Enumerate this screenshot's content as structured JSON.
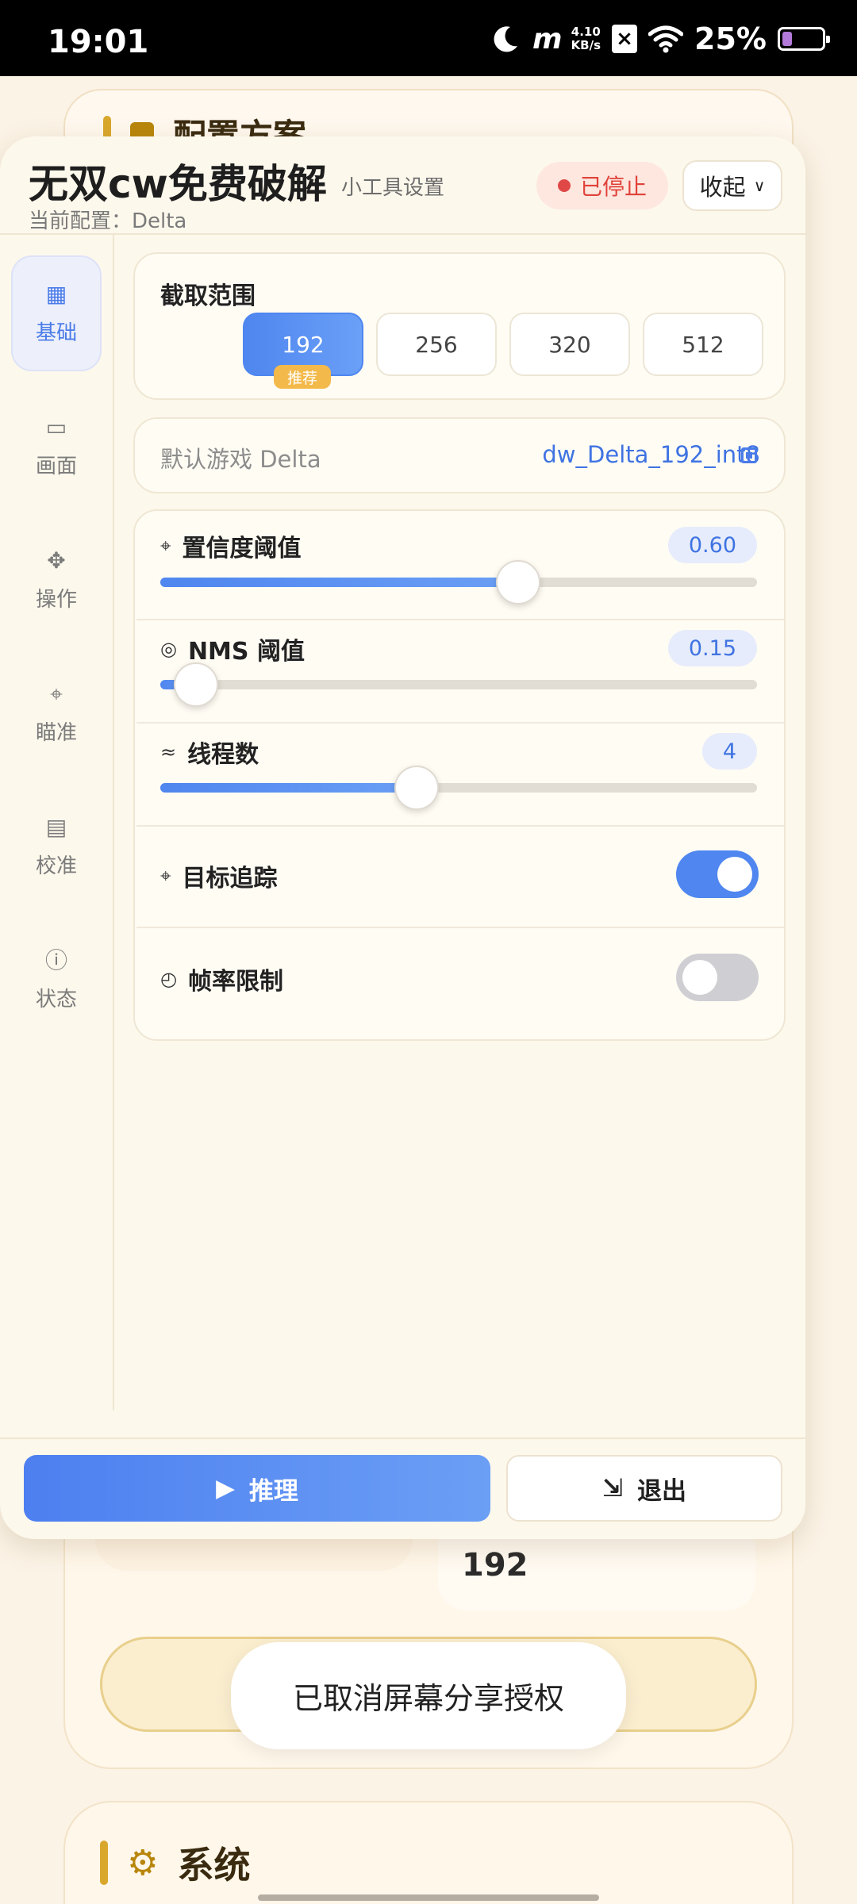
{
  "status_bar": {
    "time": "19:01",
    "net_speed_value": "4.10",
    "net_speed_unit": "KB/s",
    "carrier_glyph": "m",
    "battery_text": "25%",
    "battery_level": 0.25,
    "icons": [
      "moon-icon",
      "notification-x-icon",
      "wifi-icon",
      "battery-icon"
    ]
  },
  "background": {
    "top_card_title": "配置方案",
    "mid_value": "192",
    "system_title": "系统",
    "toast": "已取消屏幕分享授权"
  },
  "panel": {
    "title": "无双cw免费破解",
    "subtitle": "小工具设置",
    "current_config": "当前配置：Delta",
    "status_label": "已停止",
    "collapse_label": "收起",
    "nav": [
      {
        "label": "基础",
        "icon": "▦",
        "icon_name": "grid-icon",
        "active": true
      },
      {
        "label": "画面",
        "icon": "▭",
        "icon_name": "screen-icon",
        "active": false
      },
      {
        "label": "操作",
        "icon": "✥",
        "icon_name": "move-icon",
        "active": false
      },
      {
        "label": "瞄准",
        "icon": "⌖",
        "icon_name": "crosshair-icon",
        "active": false
      },
      {
        "label": "校准",
        "icon": "▤",
        "icon_name": "calibrate-icon",
        "active": false
      },
      {
        "label": "状态",
        "icon": "ⓘ",
        "icon_name": "info-icon",
        "active": false
      }
    ],
    "capture_range": {
      "title": "截取范围",
      "options": [
        "192",
        "256",
        "320",
        "512"
      ],
      "selected": "192",
      "recommended_badge": "推荐"
    },
    "default_game": {
      "label": "默认游戏 Delta",
      "model": "dw_Delta_192_int8"
    },
    "sliders": [
      {
        "label": "置信度阈值",
        "icon": "⌖",
        "value": "0.60",
        "fraction": 0.6
      },
      {
        "label": "NMS 阈值",
        "icon": "◎",
        "value": "0.15",
        "fraction": 0.06
      },
      {
        "label": "线程数",
        "icon": "≈",
        "value": "4",
        "fraction": 0.43
      }
    ],
    "toggles": [
      {
        "label": "目标追踪",
        "icon": "⌖",
        "on": true
      },
      {
        "label": "帧率限制",
        "icon": "◴",
        "on": false
      }
    ],
    "infer_label": "推理",
    "exit_label": "退出"
  },
  "colors": {
    "accent": "#4f86ef",
    "stopped": "#e0423a",
    "badge": "#f3b94a",
    "panel_bg": "#fdf8ec"
  }
}
